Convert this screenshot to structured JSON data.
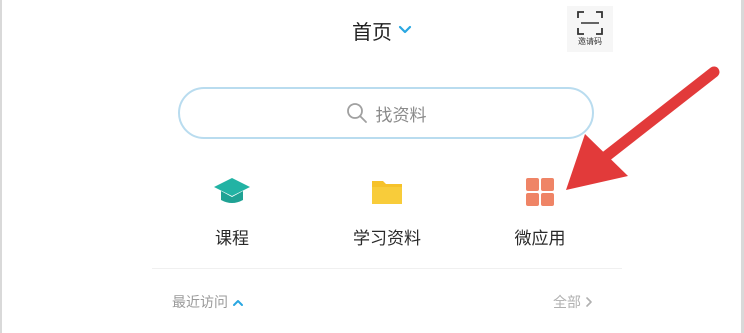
{
  "header": {
    "title": "首页",
    "scan_label": "邀请码"
  },
  "search": {
    "placeholder": "找资料"
  },
  "entries": [
    {
      "label": "课程",
      "icon": "graduation-cap-icon",
      "color": "#22b3a4"
    },
    {
      "label": "学习资料",
      "icon": "folder-icon",
      "color": "#f6c22a"
    },
    {
      "label": "微应用",
      "icon": "grid-apps-icon",
      "color": "#ef8466"
    }
  ],
  "recent": {
    "label": "最近访问",
    "all_label": "全部"
  },
  "colors": {
    "accent": "#2aa7e1",
    "annotation_arrow": "#e23a3a",
    "search_border": "#b9dcef"
  }
}
